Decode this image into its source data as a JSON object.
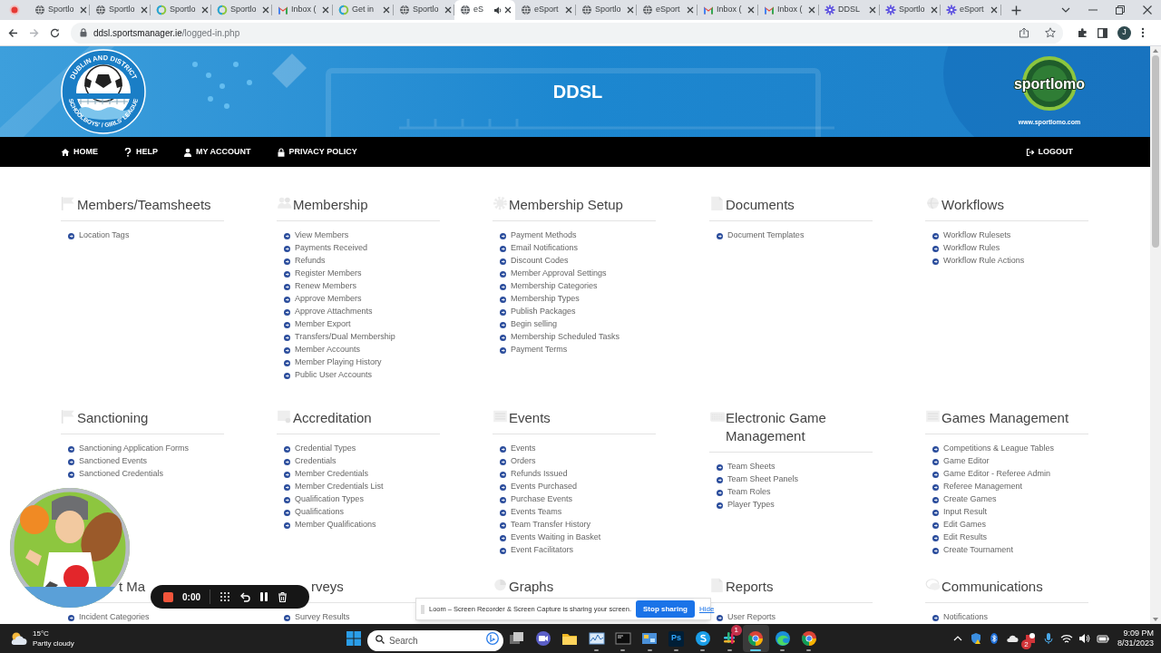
{
  "browser": {
    "tabs": [
      {
        "kind": "globe",
        "title": "Sportlo",
        "selected": false,
        "audio": false
      },
      {
        "kind": "globe",
        "title": "Sportlo",
        "selected": false,
        "audio": false
      },
      {
        "kind": "ring",
        "title": "Sportlo",
        "selected": false,
        "audio": false
      },
      {
        "kind": "ring",
        "title": "Sportlo",
        "selected": false,
        "audio": false
      },
      {
        "kind": "gmail",
        "title": "Inbox (",
        "selected": false,
        "audio": false
      },
      {
        "kind": "ring",
        "title": "Get in",
        "selected": false,
        "audio": false
      },
      {
        "kind": "globe",
        "title": "Sportlo",
        "selected": false,
        "audio": false
      },
      {
        "kind": "globe",
        "title": "eS",
        "selected": true,
        "audio": true
      },
      {
        "kind": "globe",
        "title": "eSport",
        "selected": false,
        "audio": false
      },
      {
        "kind": "globe",
        "title": "Sportlo",
        "selected": false,
        "audio": false
      },
      {
        "kind": "globe",
        "title": "eSport",
        "selected": false,
        "audio": false
      },
      {
        "kind": "gmail",
        "title": "Inbox (",
        "selected": false,
        "audio": false
      },
      {
        "kind": "gmail",
        "title": "Inbox (",
        "selected": false,
        "audio": false
      },
      {
        "kind": "star",
        "title": "DDSL",
        "selected": false,
        "audio": false
      },
      {
        "kind": "star",
        "title": "Sportlo",
        "selected": false,
        "audio": false
      },
      {
        "kind": "star",
        "title": "eSport",
        "selected": false,
        "audio": false
      }
    ],
    "url_host": "ddsl.sportsmanager.ie",
    "url_path": "/logged-in.php",
    "profile_initial": "J"
  },
  "site_header": {
    "title": "DDSL",
    "badge_top": "DUBLIN AND DISTRICT",
    "badge_bottom": "SCHOOLBOYS' / GIRLS' LEAGUE",
    "brand": "sportlomo",
    "brand_url": "www.sportlomo.com"
  },
  "nav": {
    "items": [
      {
        "kind": "home",
        "label": "HOME"
      },
      {
        "kind": "help",
        "label": "HELP"
      },
      {
        "kind": "user",
        "label": "MY ACCOUNT"
      },
      {
        "kind": "lock",
        "label": "PRIVACY POLICY"
      }
    ],
    "logout": {
      "kind": "logout",
      "label": "LOGOUT"
    }
  },
  "sections": [
    {
      "title": "Members/Teamsheets",
      "kind": "flag",
      "items": [
        "Location Tags"
      ]
    },
    {
      "title": "Membership",
      "kind": "people",
      "items": [
        "View Members",
        "Payments Received",
        "Refunds",
        "Register Members",
        "Renew Members",
        "Approve Members",
        "Approve Attachments",
        "Member Export",
        "Transfers/Dual Membership",
        "Member Accounts",
        "Member Playing History",
        "Public User Accounts"
      ]
    },
    {
      "title": "Membership Setup",
      "kind": "gear",
      "items": [
        "Payment Methods",
        "Email Notifications",
        "Discount Codes",
        "Member Approval Settings",
        "Membership Categories",
        "Membership Types",
        "Publish Packages",
        "Begin selling",
        "Membership Scheduled Tasks",
        "Payment Terms"
      ]
    },
    {
      "title": "Documents",
      "kind": "document",
      "items": [
        "Document Templates"
      ]
    },
    {
      "title": "Workflows",
      "kind": "globe",
      "items": [
        "Workflow Rulesets",
        "Workflow Rules",
        "Workflow Rule Actions"
      ]
    },
    {
      "title": "Sanctioning",
      "kind": "flag",
      "items": [
        "Sanctioning Application Forms",
        "Sanctioned Events",
        "Sanctioned Credentials"
      ]
    },
    {
      "title": "Accreditation",
      "kind": "certificate",
      "items": [
        "Credential Types",
        "Credentials",
        "Member Credentials",
        "Member Credentials List",
        "Qualification Types",
        "Qualifications",
        "Member Qualifications"
      ]
    },
    {
      "title": "Events",
      "kind": "list",
      "items": [
        "Events",
        "Orders",
        "Refunds Issued",
        "Events Purchased",
        "Purchase Events",
        "Events Teams",
        "Team Transfer History",
        "Events Waiting in Basket",
        "Event Facilitators"
      ]
    },
    {
      "title": "Electronic Game Management",
      "kind": "keyboard",
      "items": [
        "Team Sheets",
        "Team Sheet Panels",
        "Team Roles",
        "Player Types"
      ]
    },
    {
      "title": "Games Management",
      "kind": "list",
      "items": [
        "Competitions & League Tables",
        "Game Editor",
        "Game Editor - Referee Admin",
        "Referee Management",
        "Create Games",
        "Input Result",
        "Edit Games",
        "Edit Results",
        "Create Tournament"
      ]
    },
    {
      "title": "t Ma",
      "title_cut": true,
      "items": [
        "Incident Categories"
      ]
    },
    {
      "title": "rveys",
      "title_cut": true,
      "items": [
        "Survey Results"
      ]
    },
    {
      "title": "Graphs",
      "kind": "chart"
    },
    {
      "title": "Reports",
      "kind": "document",
      "items": [
        "User Reports"
      ]
    },
    {
      "title": "Communications",
      "kind": "chat",
      "items": [
        "Notifications"
      ]
    }
  ],
  "loom": {
    "timer": "0:00",
    "banner": "Loom – Screen Recorder & Screen Capture is sharing your screen.",
    "stop": "Stop sharing",
    "hide": "Hide"
  },
  "taskbar": {
    "temperature": "15°C",
    "weather": "Partly cloudy",
    "search_placeholder": "Search",
    "apps": [
      {
        "kind": "task-view",
        "open": false,
        "selected": false
      },
      {
        "kind": "teams",
        "open": false,
        "selected": false
      },
      {
        "kind": "folder",
        "open": false,
        "selected": false
      },
      {
        "kind": "monitor",
        "open": true,
        "selected": false
      },
      {
        "kind": "terminal",
        "open": true,
        "selected": false
      },
      {
        "kind": "control-panel",
        "open": true,
        "selected": false
      },
      {
        "kind": "photoshop",
        "label": "Ps",
        "open": true,
        "selected": false
      },
      {
        "kind": "skype",
        "open": true,
        "selected": false
      },
      {
        "kind": "slack",
        "badge": "1",
        "open": true,
        "selected": false
      },
      {
        "kind": "chrome",
        "open": true,
        "selected": true
      },
      {
        "kind": "edge",
        "open": true,
        "selected": false
      },
      {
        "kind": "chrome",
        "open": true,
        "selected": false
      }
    ],
    "tray": [
      {
        "kind": "chevron"
      },
      {
        "kind": "shield"
      },
      {
        "kind": "bluetooth"
      },
      {
        "kind": "cloud"
      },
      {
        "kind": "app",
        "badge": "2"
      },
      {
        "kind": "mic"
      },
      {
        "kind": "wifi"
      },
      {
        "kind": "volume"
      },
      {
        "kind": "battery"
      }
    ],
    "time": "9:09 PM",
    "date": "8/31/2023"
  }
}
